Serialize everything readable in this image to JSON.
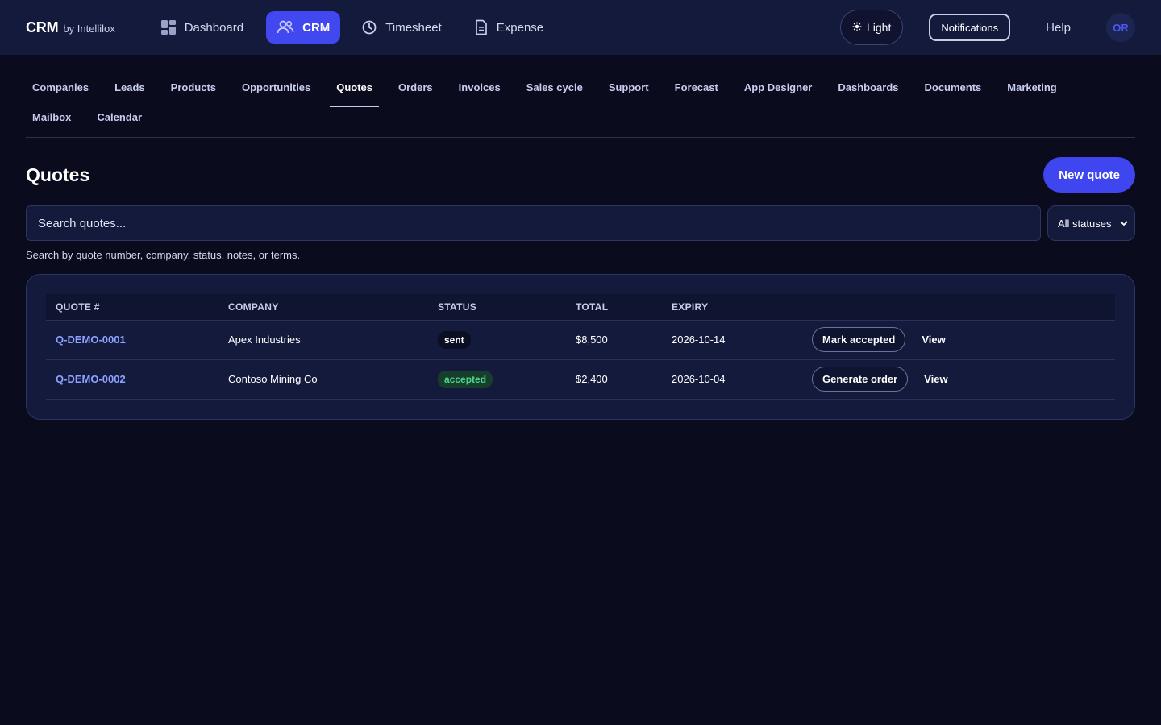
{
  "brand": {
    "name": "CRM",
    "by": "by Intellilox"
  },
  "apps": [
    {
      "label": "Dashboard",
      "icon": "dashboard-grid-icon",
      "active": false
    },
    {
      "label": "CRM",
      "icon": "users-icon",
      "active": true
    },
    {
      "label": "Timesheet",
      "icon": "clock-icon",
      "active": false
    },
    {
      "label": "Expense",
      "icon": "document-icon",
      "active": false
    }
  ],
  "topright": {
    "theme_label": "Light",
    "notifications_label": "Notifications",
    "help_label": "Help",
    "avatar_initials": "OR"
  },
  "subnav": [
    {
      "label": "Companies"
    },
    {
      "label": "Leads"
    },
    {
      "label": "Products"
    },
    {
      "label": "Opportunities"
    },
    {
      "label": "Quotes",
      "active": true
    },
    {
      "label": "Orders"
    },
    {
      "label": "Invoices"
    },
    {
      "label": "Sales cycle"
    },
    {
      "label": "Support"
    },
    {
      "label": "Forecast"
    },
    {
      "label": "App Designer"
    },
    {
      "label": "Dashboards"
    },
    {
      "label": "Documents"
    },
    {
      "label": "Marketing"
    },
    {
      "label": "Mailbox"
    },
    {
      "label": "Calendar"
    }
  ],
  "page": {
    "title": "Quotes",
    "new_button": "New quote",
    "search_placeholder": "Search quotes...",
    "status_filter": "All statuses",
    "hint": "Search by quote number, company, status, notes, or terms."
  },
  "table": {
    "columns": [
      "QUOTE #",
      "COMPANY",
      "STATUS",
      "TOTAL",
      "EXPIRY",
      ""
    ],
    "rows": [
      {
        "quote": "Q-DEMO-0001",
        "company": "Apex Industries",
        "status": "sent",
        "total": "$8,500",
        "expiry": "2026-10-14",
        "action": "Mark accepted",
        "view": "View"
      },
      {
        "quote": "Q-DEMO-0002",
        "company": "Contoso Mining Co",
        "status": "accepted",
        "total": "$2,400",
        "expiry": "2026-10-04",
        "action": "Generate order",
        "view": "View"
      }
    ]
  },
  "colors": {
    "background": "#0a0c1e",
    "topbar": "#141a3c",
    "accent": "#4248f0",
    "link": "#8ea1ff",
    "accepted_text": "#4ad48a"
  }
}
